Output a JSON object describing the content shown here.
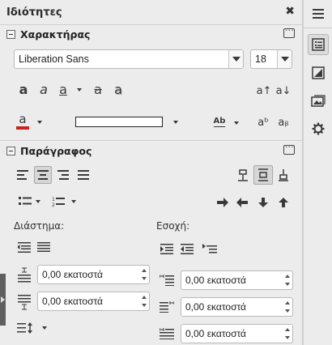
{
  "deck": {
    "title": "Ιδιότητες",
    "close_glyph": "✖"
  },
  "character": {
    "header": "Χαρακτήρας",
    "font_name": "Liberation Sans",
    "font_size": "18",
    "buttons": {
      "bold": "a",
      "italic": "a",
      "underline": "a",
      "strike": "a",
      "shadow": "a",
      "grow": "a↑",
      "shrink": "a↓",
      "font_color": "a",
      "spacing": "Ab",
      "superscript": "aᵇ",
      "subscript": "aᵦ"
    },
    "font_color_hex": "#c9211e",
    "highlight_hex": "#ffffff"
  },
  "paragraph": {
    "header": "Παράγραφος",
    "spacing_label": "Διάστημα:",
    "indent_label": "Εσοχή:",
    "above_spacing": "0,00 εκατοστά",
    "below_spacing": "0,00 εκατοστά",
    "before_indent": "0,00 εκατοστά",
    "after_indent": "0,00 εκατοστά",
    "first_line_indent": "0,00 εκατοστά"
  }
}
